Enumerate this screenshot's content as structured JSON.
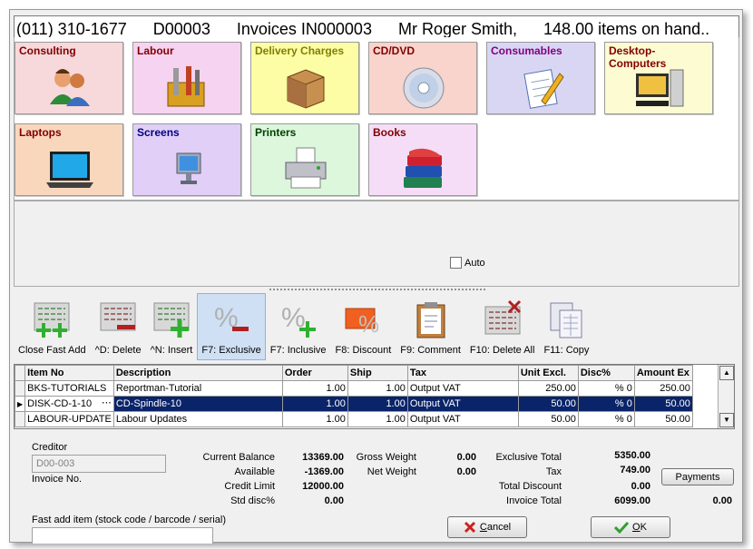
{
  "header": {
    "phone": "(011) 310-1677",
    "debtor": "D00003",
    "doc": "Invoices IN000003",
    "customer": "Mr Roger Smith,",
    "stock": "148.00 items on hand.."
  },
  "categories": [
    {
      "label": "Consulting",
      "color": "#f7d9db",
      "label_color": "#800000",
      "icon": "people-icon"
    },
    {
      "label": "Labour",
      "color": "#f6d3f0",
      "label_color": "#800000",
      "icon": "tools-icon"
    },
    {
      "label": "Delivery Charges",
      "color": "#fdfda5",
      "label_color": "#808000",
      "icon": "box-icon"
    },
    {
      "label": "CD/DVD",
      "color": "#f8d4cc",
      "label_color": "#800000",
      "icon": "disc-icon"
    },
    {
      "label": "Consumables",
      "color": "#d9d6f4",
      "label_color": "#800080",
      "icon": "notepad-icon"
    },
    {
      "label": "Desktop-Computers",
      "color": "#fdfbd2",
      "label_color": "#800000",
      "icon": "desktop-icon"
    },
    {
      "label": "Laptops",
      "color": "#f9d7bd",
      "label_color": "#800000",
      "icon": "laptop-icon"
    },
    {
      "label": "Screens",
      "color": "#e1cff7",
      "label_color": "#000080",
      "icon": "monitor-icon"
    },
    {
      "label": "Printers",
      "color": "#dcf7dc",
      "label_color": "#004000",
      "icon": "printer-icon"
    },
    {
      "label": "Books",
      "color": "#f6ddf7",
      "label_color": "#800000",
      "icon": "books-icon"
    }
  ],
  "auto_label": "Auto",
  "toolbar": [
    {
      "label": "Close Fast Add",
      "icon": "close-fast-add-icon"
    },
    {
      "label": "^D: Delete",
      "icon": "delete-row-icon"
    },
    {
      "label": "^N: Insert",
      "icon": "insert-row-icon"
    },
    {
      "label": "F7: Exclusive",
      "icon": "exclusive-percent-icon"
    },
    {
      "label": "F7: Inclusive",
      "icon": "inclusive-percent-icon"
    },
    {
      "label": "F8: Discount",
      "icon": "discount-icon"
    },
    {
      "label": "F9: Comment",
      "icon": "clipboard-icon"
    },
    {
      "label": "F10: Delete All",
      "icon": "delete-all-icon"
    },
    {
      "label": "F11: Copy",
      "icon": "copy-icon"
    }
  ],
  "grid": {
    "columns": [
      "Item No",
      "Description",
      "Order",
      "Ship",
      "Tax",
      "Unit Excl.",
      "Disc%",
      "Amount Ex"
    ],
    "rows": [
      {
        "item": "BKS-TUTORIALS",
        "desc": "Reportman-Tutorial",
        "order": "1.00",
        "ship": "1.00",
        "tax": "Output VAT",
        "unit": "250.00",
        "disc": "% 0",
        "amount": "250.00"
      },
      {
        "item": "DISK-CD-1-10",
        "desc": "CD-Spindle-10",
        "order": "1.00",
        "ship": "1.00",
        "tax": "Output VAT",
        "unit": "50.00",
        "disc": "% 0",
        "amount": "50.00"
      },
      {
        "item": "LABOUR-UPDATE",
        "desc": "Labour Updates",
        "order": "1.00",
        "ship": "1.00",
        "tax": "Output VAT",
        "unit": "50.00",
        "disc": "% 0",
        "amount": "50.00"
      }
    ],
    "ellipsis": "⋯"
  },
  "summary": {
    "creditor_label": "Creditor",
    "creditor_value": "D00-003",
    "invoice_no_label": "Invoice No.",
    "current_balance_label": "Current Balance",
    "current_balance": "13369.00",
    "available_label": "Available",
    "available": "-1369.00",
    "credit_limit_label": "Credit Limit",
    "credit_limit": "12000.00",
    "std_disc_label": "Std disc%",
    "std_disc": "0.00",
    "gross_weight_label": "Gross Weight",
    "gross_weight": "0.00",
    "net_weight_label": "Net Weight",
    "net_weight": "0.00",
    "exclusive_total_label": "Exclusive Total",
    "exclusive_total": "5350.00",
    "tax_label": "Tax",
    "tax": "749.00",
    "total_discount_label": "Total Discount",
    "total_discount": "0.00",
    "invoice_total_label": "Invoice Total",
    "invoice_total": "6099.00",
    "payments_label": "Payments",
    "payments": "0.00",
    "fast_add_label": "Fast add item (stock code / barcode / serial)",
    "cancel_hotkey": "C",
    "cancel_rest": "ancel",
    "ok_hotkey": "O",
    "ok_rest": "K"
  }
}
